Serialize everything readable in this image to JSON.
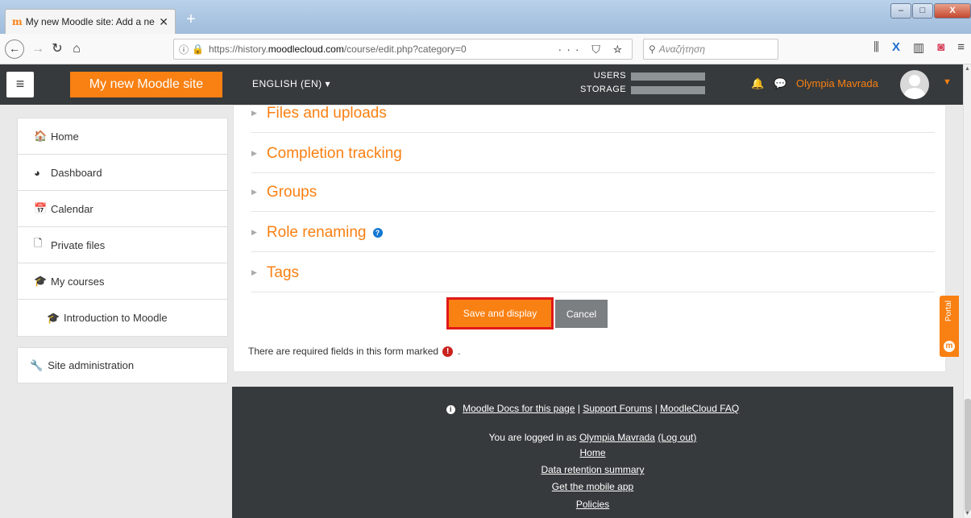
{
  "browser": {
    "tab_title": "My new Moodle site: Add a ne",
    "tab_icon": "m",
    "close_glyph": "✕",
    "new_tab_glyph": "+",
    "window_controls": [
      "–",
      "□",
      "X"
    ],
    "url_plain_prefix": "https://history.",
    "url_domain": "moodlecloud.com",
    "url_path": "/course/edit.php?category=0",
    "urlbar_icons": "··· ⛉ ☆",
    "search_placeholder": "Αναζήτηση"
  },
  "header": {
    "site_name": "My new Moodle site",
    "language": "ENGLISH (EN) ▾",
    "users_label": "USERS",
    "storage_label": "STORAGE",
    "user_name": "Olympia Mavrada"
  },
  "nav": {
    "items": [
      {
        "label": "Home",
        "icon": "home-icon"
      },
      {
        "label": "Dashboard",
        "icon": "dashboard-icon"
      },
      {
        "label": "Calendar",
        "icon": "calendar-icon"
      },
      {
        "label": "Private files",
        "icon": "file-icon"
      },
      {
        "label": "My courses",
        "icon": "graduation-cap-icon"
      },
      {
        "label": "Introduction to Moodle",
        "icon": "graduation-cap-icon"
      }
    ],
    "admin_label": "Site administration"
  },
  "main": {
    "sections": [
      "Files and uploads",
      "Completion tracking",
      "Groups",
      "Role renaming",
      "Tags"
    ],
    "save_label": "Save and display",
    "cancel_label": "Cancel",
    "required_text": "There are required fields in this form marked",
    "required_suffix": "."
  },
  "portal_label": "Portal",
  "footer": {
    "docs_link": "Moodle Docs for this page",
    "forums_link": "Support Forums",
    "faq_link": "MoodleCloud FAQ",
    "separator": "|",
    "logged_in_prefix": "You are logged in as",
    "logged_in_user": "Olympia Mavrada",
    "logout": "(Log out)",
    "home": "Home",
    "data_retention": "Data retention summary",
    "mobile_app": "Get the mobile app",
    "policies": "Policies"
  },
  "colors": {
    "brand_orange": "#f98012",
    "header_dark": "#373a3c",
    "highlight_red": "#e01919"
  }
}
